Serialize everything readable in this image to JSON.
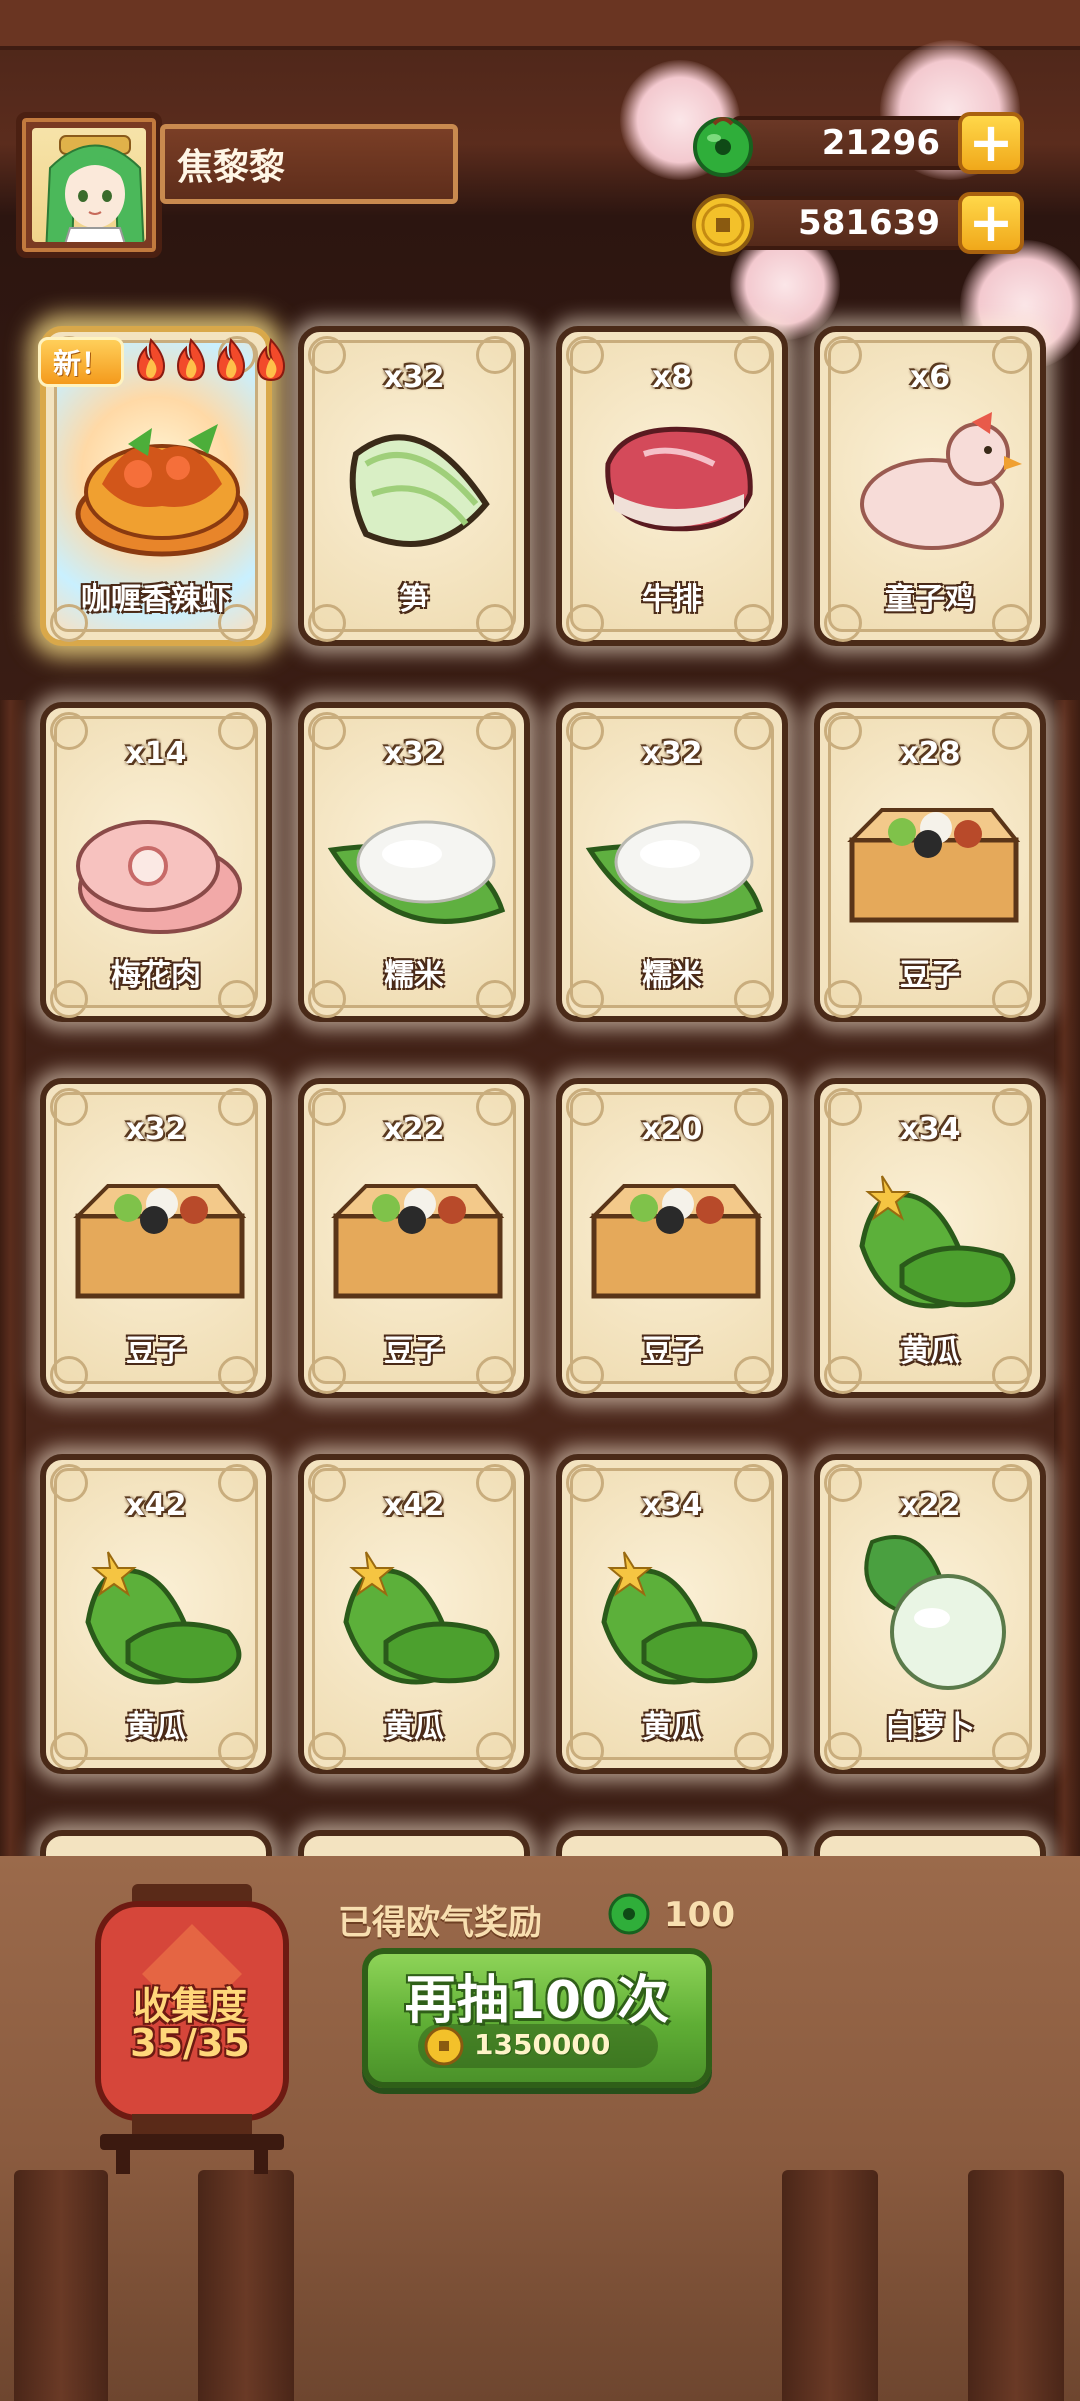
{
  "player": {
    "name": "焦黎黎",
    "avatar_icon": "green-haired-girl-avatar"
  },
  "currencies": [
    {
      "name": "jade",
      "icon": "jade-icon",
      "value": "21296",
      "plus": "+"
    },
    {
      "name": "coin",
      "icon": "coin-icon",
      "value": "581639",
      "plus": "+"
    }
  ],
  "new_badge": "新！",
  "cards": [
    {
      "label": "咖喱香辣虾",
      "count": "",
      "icon": "curry-shrimp-icon",
      "special": true,
      "flames": 4
    },
    {
      "label": "笋",
      "count": "x32",
      "icon": "bamboo-shoot-icon"
    },
    {
      "label": "牛排",
      "count": "x8",
      "icon": "steak-icon"
    },
    {
      "label": "童子鸡",
      "count": "x6",
      "icon": "chicken-icon"
    },
    {
      "label": "梅花肉",
      "count": "x14",
      "icon": "pork-icon"
    },
    {
      "label": "糯米",
      "count": "x32",
      "icon": "sticky-rice-icon"
    },
    {
      "label": "糯米",
      "count": "x32",
      "icon": "sticky-rice-icon"
    },
    {
      "label": "豆子",
      "count": "x28",
      "icon": "beans-box-icon"
    },
    {
      "label": "豆子",
      "count": "x32",
      "icon": "beans-box-icon"
    },
    {
      "label": "豆子",
      "count": "x22",
      "icon": "beans-box-icon"
    },
    {
      "label": "豆子",
      "count": "x20",
      "icon": "beans-box-icon"
    },
    {
      "label": "黄瓜",
      "count": "x34",
      "icon": "cucumber-icon"
    },
    {
      "label": "黄瓜",
      "count": "x42",
      "icon": "cucumber-icon"
    },
    {
      "label": "黄瓜",
      "count": "x42",
      "icon": "cucumber-icon"
    },
    {
      "label": "黄瓜",
      "count": "x34",
      "icon": "cucumber-icon"
    },
    {
      "label": "白萝卜",
      "count": "x22",
      "icon": "radish-icon"
    }
  ],
  "collection": {
    "title": "收集度",
    "count": "35/35"
  },
  "reward": {
    "text": "已得欧气奖励",
    "icon": "jade-icon",
    "value": "100"
  },
  "draw_button": {
    "label": "再抽100次",
    "cost_icon": "coin-icon",
    "cost": "1350000"
  },
  "colors": {
    "card_bg": "#f3e3c0",
    "card_border": "#4a2a18",
    "button_green": "#5fae35",
    "gold": "#f0a81a",
    "jade": "#2fae3a"
  }
}
